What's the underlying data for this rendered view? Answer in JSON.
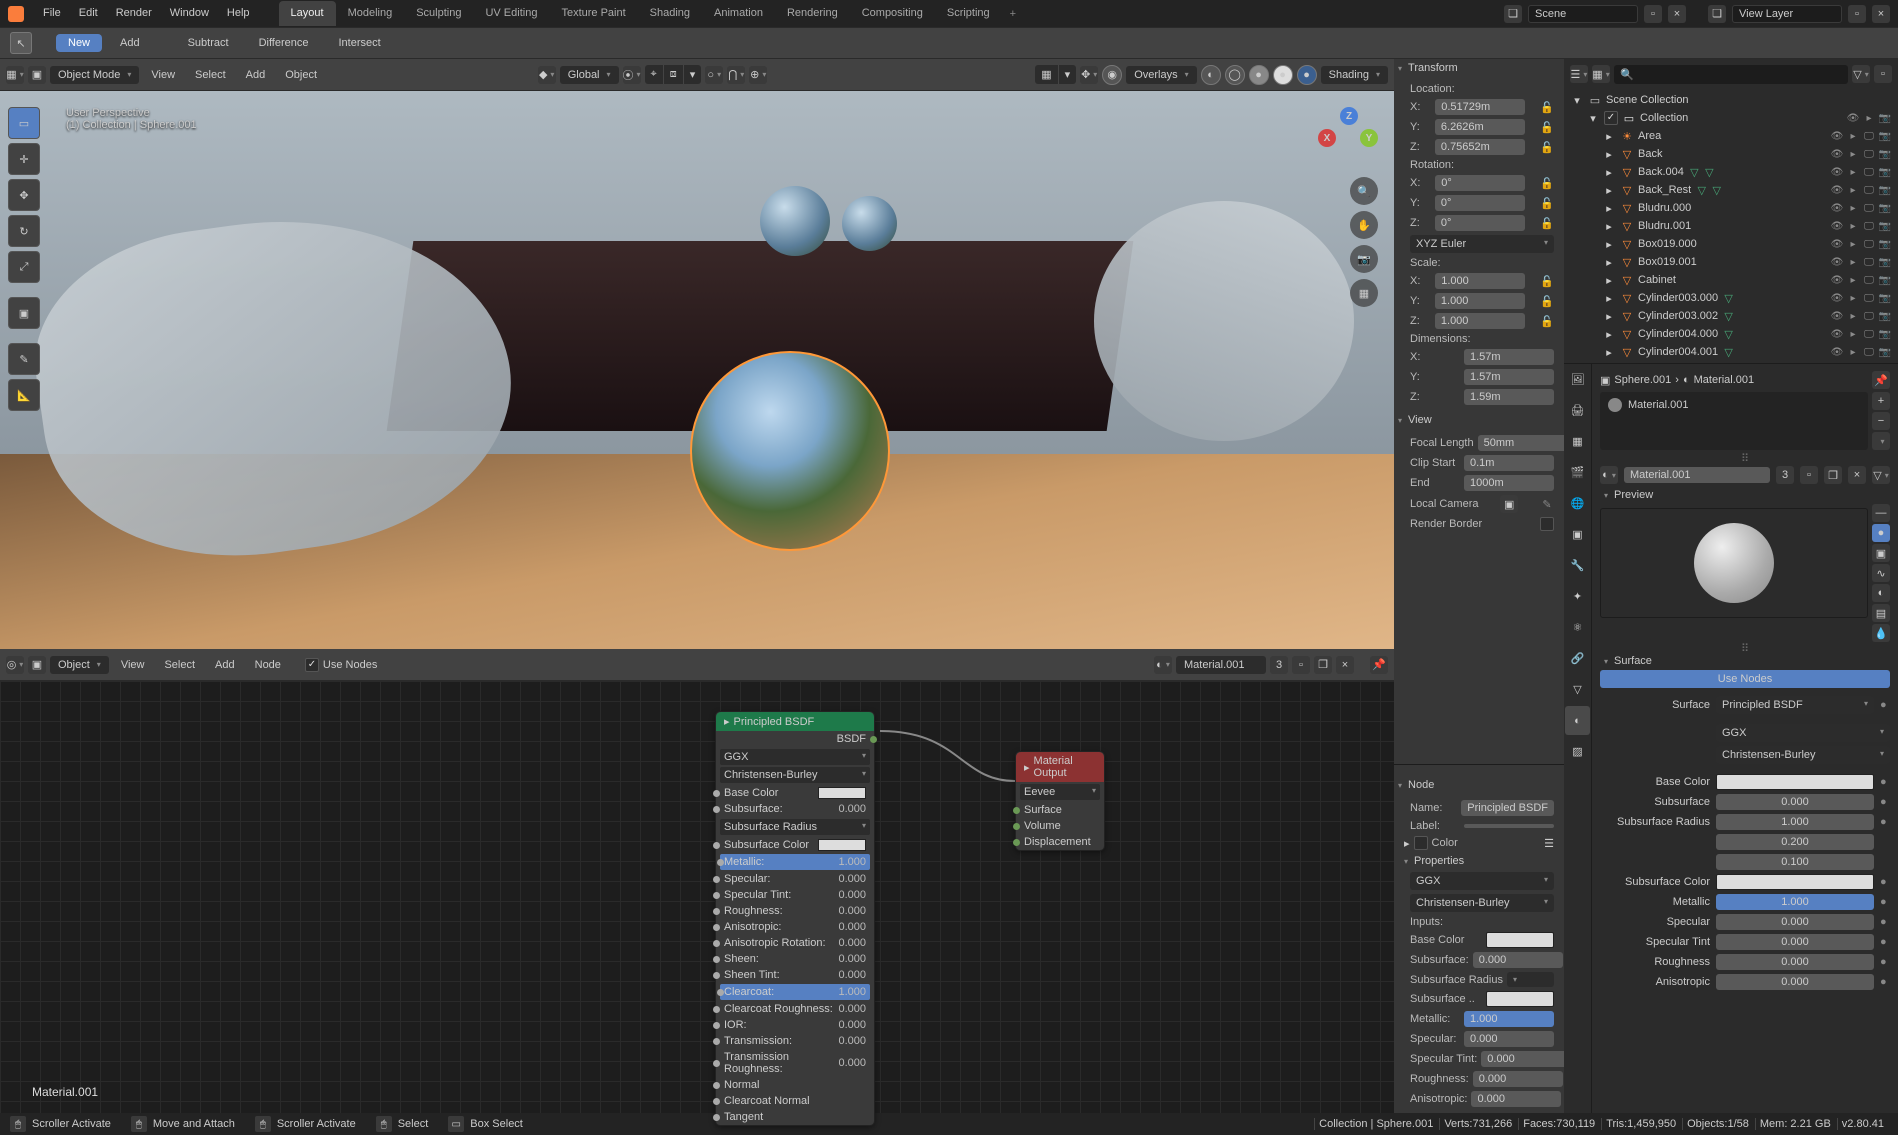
{
  "topbar": {
    "menus": [
      "File",
      "Edit",
      "Render",
      "Window",
      "Help"
    ],
    "tabs": [
      "Layout",
      "Modeling",
      "Sculpting",
      "UV Editing",
      "Texture Paint",
      "Shading",
      "Animation",
      "Rendering",
      "Compositing",
      "Scripting"
    ],
    "active_tab": 0,
    "scene_label": "Scene",
    "viewlayer_label": "View Layer"
  },
  "toolrow": {
    "new": "New",
    "add": "Add",
    "subtract": "Subtract",
    "difference": "Difference",
    "intersect": "Intersect"
  },
  "view_header": {
    "mode": "Object Mode",
    "menus": [
      "View",
      "Select",
      "Add",
      "Object"
    ],
    "orient": "Global",
    "overlays": "Overlays",
    "shading": "Shading"
  },
  "viewport": {
    "perspective": "User Perspective",
    "breadcrumb": "(1) Collection | Sphere.001",
    "axes": {
      "x": "X",
      "y": "Y",
      "z": "Z"
    }
  },
  "node_header": {
    "type": "Object",
    "menus": [
      "View",
      "Select",
      "Add",
      "Node"
    ],
    "use_nodes": "Use Nodes",
    "material": "Material.001",
    "users": "3"
  },
  "nodes": {
    "principled": {
      "title": "Principled BSDF",
      "out": "BSDF",
      "dist": "GGX",
      "sss": "Christensen-Burley",
      "rows": [
        {
          "lbl": "Base Color",
          "swatch": true
        },
        {
          "lbl": "Subsurface:",
          "val": "0.000"
        },
        {
          "lbl": "Subsurface Radius",
          "sel": true
        },
        {
          "lbl": "Subsurface Color",
          "swatch": true
        },
        {
          "lbl": "Metallic:",
          "val": "1.000",
          "hl": true
        },
        {
          "lbl": "Specular:",
          "val": "0.000"
        },
        {
          "lbl": "Specular Tint:",
          "val": "0.000"
        },
        {
          "lbl": "Roughness:",
          "val": "0.000"
        },
        {
          "lbl": "Anisotropic:",
          "val": "0.000"
        },
        {
          "lbl": "Anisotropic Rotation:",
          "val": "0.000"
        },
        {
          "lbl": "Sheen:",
          "val": "0.000"
        },
        {
          "lbl": "Sheen Tint:",
          "val": "0.000"
        },
        {
          "lbl": "Clearcoat:",
          "val": "1.000",
          "hl": true
        },
        {
          "lbl": "Clearcoat Roughness:",
          "val": "0.000"
        },
        {
          "lbl": "IOR:",
          "val": "0.000"
        },
        {
          "lbl": "Transmission:",
          "val": "0.000"
        },
        {
          "lbl": "Transmission Roughness:",
          "val": "0.000"
        },
        {
          "lbl": "Normal"
        },
        {
          "lbl": "Clearcoat Normal"
        },
        {
          "lbl": "Tangent"
        }
      ]
    },
    "output": {
      "title": "Material Output",
      "target": "Eevee",
      "rows": [
        "Surface",
        "Volume",
        "Displacement"
      ]
    },
    "footer_label": "Material.001"
  },
  "n_panel": {
    "transform": "Transform",
    "location": "Location:",
    "loc": {
      "x": "0.51729m",
      "y": "6.2626m",
      "z": "0.75652m"
    },
    "rotation": "Rotation:",
    "rot": {
      "x": "0°",
      "y": "0°",
      "z": "0°"
    },
    "rot_mode": "XYZ Euler",
    "scale": "Scale:",
    "scl": {
      "x": "1.000",
      "y": "1.000",
      "z": "1.000"
    },
    "dimensions": "Dimensions:",
    "dim": {
      "x": "1.57m",
      "y": "1.57m",
      "z": "1.59m"
    },
    "view": "View",
    "focal_lbl": "Focal Length",
    "focal": "50mm",
    "clip_lbl": "Clip Start",
    "clip": "0.1m",
    "end_lbl": "End",
    "end": "1000m",
    "local_cam": "Local Camera",
    "render_border": "Render Border",
    "node": "Node",
    "name_lbl": "Name:",
    "name": "Principled BSDF",
    "label_lbl": "Label:",
    "color": "Color",
    "properties": "Properties",
    "dist": "GGX",
    "sss": "Christensen-Burley",
    "inputs_lbl": "Inputs:",
    "inputs": [
      {
        "lbl": "Base Color",
        "swatch": true
      },
      {
        "lbl": "Subsurface:",
        "val": "0.000"
      },
      {
        "lbl": "Subsurface Radius",
        "sel": true
      },
      {
        "lbl": "Subsurface ..",
        "swatch": true
      },
      {
        "lbl": "Metallic:",
        "val": "1.000",
        "hl": true
      },
      {
        "lbl": "Specular:",
        "val": "0.000"
      },
      {
        "lbl": "Specular Tint:",
        "val": "0.000"
      },
      {
        "lbl": "Roughness:",
        "val": "0.000"
      },
      {
        "lbl": "Anisotropic:",
        "val": "0.000"
      }
    ]
  },
  "outliner": {
    "root": "Scene Collection",
    "collection": "Collection",
    "items": [
      {
        "name": "Area",
        "ic": "light"
      },
      {
        "name": "Back",
        "ic": "mesh"
      },
      {
        "name": "Back.004",
        "ic": "mesh",
        "extra": 2
      },
      {
        "name": "Back_Rest",
        "ic": "mesh",
        "extra": 2
      },
      {
        "name": "Bludru.000",
        "ic": "mesh"
      },
      {
        "name": "Bludru.001",
        "ic": "mesh"
      },
      {
        "name": "Box019.000",
        "ic": "mesh"
      },
      {
        "name": "Box019.001",
        "ic": "mesh"
      },
      {
        "name": "Cabinet",
        "ic": "mesh"
      },
      {
        "name": "Cylinder003.000",
        "ic": "mesh",
        "extra": 1
      },
      {
        "name": "Cylinder003.002",
        "ic": "mesh",
        "extra": 1
      },
      {
        "name": "Cylinder004.000",
        "ic": "mesh",
        "extra": 1
      },
      {
        "name": "Cylinder004.001",
        "ic": "mesh",
        "extra": 1
      }
    ]
  },
  "props": {
    "crumb_obj": "Sphere.001",
    "crumb_mat": "Material.001",
    "matlist": "Material.001",
    "mat_field": "Material.001",
    "users": "3",
    "preview": "Preview",
    "surface": "Surface",
    "use_nodes": "Use Nodes",
    "surface_lbl": "Surface",
    "surface_val": "Principled BSDF",
    "dist": "GGX",
    "sss": "Christensen-Burley",
    "rows": [
      {
        "lbl": "Base Color",
        "swatch": true
      },
      {
        "lbl": "Subsurface",
        "val": "0.000"
      },
      {
        "lbl": "Subsurface Radius",
        "triple": [
          "1.000",
          "0.200",
          "0.100"
        ]
      },
      {
        "lbl": "Subsurface Color",
        "swatch": true
      },
      {
        "lbl": "Metallic",
        "val": "1.000",
        "hl": true
      },
      {
        "lbl": "Specular",
        "val": "0.000"
      },
      {
        "lbl": "Specular Tint",
        "val": "0.000"
      },
      {
        "lbl": "Roughness",
        "val": "0.000"
      },
      {
        "lbl": "Anisotropic",
        "val": "0.000"
      }
    ]
  },
  "status": {
    "left": [
      {
        "ic": "🖱",
        "txt": "Scroller Activate"
      },
      {
        "ic": "🖱",
        "txt": "Move and Attach"
      },
      {
        "ic": "🖱",
        "txt": "Scroller Activate"
      },
      {
        "ic": "🖱",
        "txt": "Select"
      },
      {
        "ic": "▭",
        "txt": "Box Select"
      }
    ],
    "right": [
      "Collection | Sphere.001",
      "Verts:731,266",
      "Faces:730,119",
      "Tris:1,459,950",
      "Objects:1/58",
      "Mem: 2.21 GB",
      "v2.80.41"
    ]
  }
}
